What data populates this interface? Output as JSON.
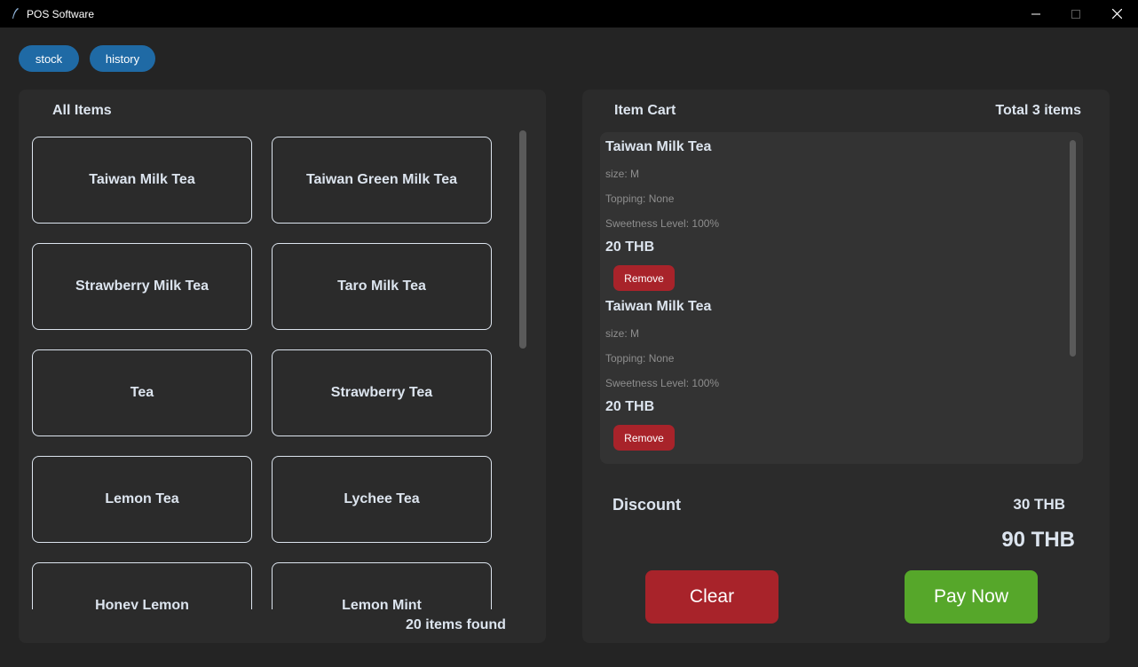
{
  "window": {
    "title": "POS Software",
    "minimize_glyph": "—",
    "maximize_glyph": "☐",
    "close_glyph": "✕"
  },
  "nav": {
    "stock_label": "stock",
    "history_label": "history"
  },
  "items_panel": {
    "title": "All Items",
    "items": [
      "Taiwan Milk Tea",
      "Taiwan Green Milk Tea",
      "Strawberry Milk Tea",
      "Taro Milk Tea",
      "Tea",
      "Strawberry Tea",
      "Lemon Tea",
      "Lychee Tea",
      "Honey Lemon",
      "Lemon Mint"
    ],
    "count_text": "20 items found"
  },
  "cart": {
    "title": "Item Cart",
    "total_items_text": "Total 3 items",
    "entries": [
      {
        "name": "Taiwan Milk Tea",
        "size": "size: M",
        "topping": "Topping: None",
        "sweetness": "Sweetness Level: 100%",
        "price": "20 THB",
        "remove_label": "Remove"
      },
      {
        "name": "Taiwan Milk Tea",
        "size": "size: M",
        "topping": "Topping: None",
        "sweetness": "Sweetness Level: 100%",
        "price": "20 THB",
        "remove_label": "Remove"
      }
    ],
    "discount_label": "Discount",
    "discount_value": "30 THB",
    "total_value": "90 THB",
    "clear_label": "Clear",
    "pay_label": "Pay Now"
  },
  "colors": {
    "accent_blue": "#1f6aa5",
    "danger_red": "#a8232a",
    "success_green": "#56a72a"
  }
}
